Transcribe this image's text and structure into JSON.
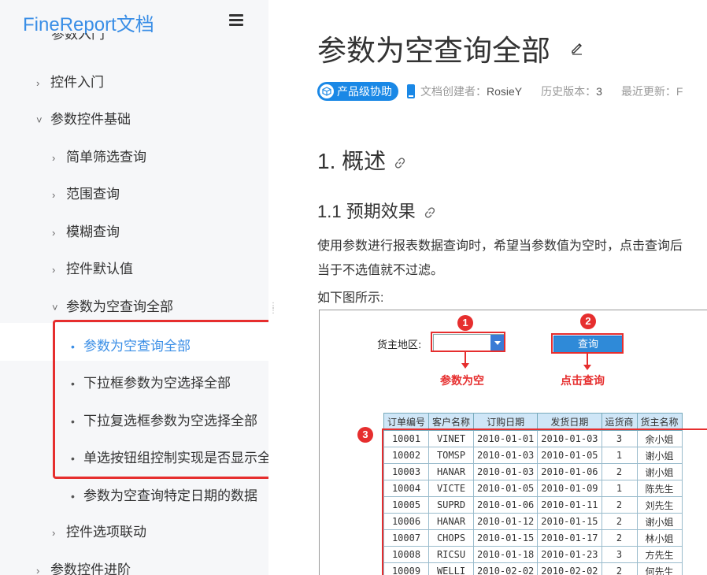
{
  "sidebar": {
    "brand": "FineReport文档",
    "cut_item": "参数入门",
    "items": [
      {
        "label": "控件入门",
        "chev": "›"
      },
      {
        "label": "参数控件基础",
        "chev": "˅"
      },
      {
        "label": "简单筛选查询",
        "chev": "›"
      },
      {
        "label": "范围查询",
        "chev": "›"
      },
      {
        "label": "模糊查询",
        "chev": "›"
      },
      {
        "label": "控件默认值",
        "chev": "›"
      },
      {
        "label": "参数为空查询全部",
        "chev": "˅"
      },
      {
        "label": "参数为空查询全部"
      },
      {
        "label": "下拉框参数为空选择全部"
      },
      {
        "label": "下拉复选框参数为空选择全部"
      },
      {
        "label": "单选按钮组控制实现是否显示全"
      },
      {
        "label": "参数为空查询特定日期的数据"
      },
      {
        "label": "控件选项联动",
        "chev": "›"
      },
      {
        "label": "参数控件进阶",
        "chev": "›"
      }
    ]
  },
  "main": {
    "title": "参数为空查询全部",
    "badge": "产品级协助",
    "creator_label": "文档创建者：",
    "creator": "RosieY",
    "history_label": "历史版本：",
    "history": "3",
    "updated_label": "最近更新：F",
    "h1": "1. 概述",
    "h2": "1.1 预期效果",
    "para1": "使用参数进行报表数据查询时，希望当参数值为空时，点击查询后",
    "para2": "当于不选值就不过滤。",
    "para3": "如下图所示:"
  },
  "figure": {
    "label_region": "货主地区:",
    "query_button": "查询",
    "note_empty": "参数为空",
    "note_click": "点击查询",
    "step1": "1",
    "step2": "2",
    "step3": "3",
    "headers": [
      "订单编号",
      "客户名称",
      "订购日期",
      "发货日期",
      "运货商",
      "货主名称"
    ],
    "rows": [
      [
        "10001",
        "VINET",
        "2010-01-01",
        "2010-01-03",
        "3",
        "余小姐"
      ],
      [
        "10002",
        "TOMSP",
        "2010-01-03",
        "2010-01-05",
        "1",
        "谢小姐"
      ],
      [
        "10003",
        "HANAR",
        "2010-01-03",
        "2010-01-06",
        "2",
        "谢小姐"
      ],
      [
        "10004",
        "VICTE",
        "2010-01-05",
        "2010-01-09",
        "1",
        "陈先生"
      ],
      [
        "10005",
        "SUPRD",
        "2010-01-06",
        "2010-01-11",
        "2",
        "刘先生"
      ],
      [
        "10006",
        "HANAR",
        "2010-01-12",
        "2010-01-15",
        "2",
        "谢小姐"
      ],
      [
        "10007",
        "CHOPS",
        "2010-01-15",
        "2010-01-17",
        "2",
        "林小姐"
      ],
      [
        "10008",
        "RICSU",
        "2010-01-18",
        "2010-01-23",
        "3",
        "方先生"
      ],
      [
        "10009",
        "WELLI",
        "2010-02-02",
        "2010-02-02",
        "2",
        "何先生"
      ]
    ]
  },
  "colors": {
    "accent": "#3a8ee6",
    "highlight": "#e62e2e",
    "badge": "#1a88e6"
  }
}
